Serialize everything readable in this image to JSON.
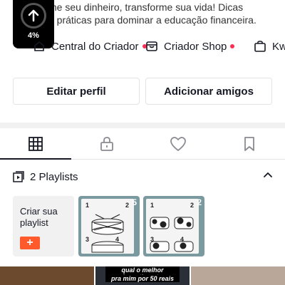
{
  "bio": {
    "line1": "me seu dinheiro, transforme sua vida! Dicas",
    "line2": "e práticas para dominar a educação financeira."
  },
  "upload": {
    "percent_label": "4%",
    "progress": 0.04,
    "icon": "arrow-up-icon"
  },
  "links": {
    "central": "Central do Criador",
    "shop": "Criador Shop",
    "kw": "Kw"
  },
  "actions": {
    "edit_profile": "Editar perfil",
    "add_friends": "Adicionar amigos"
  },
  "tabs": [
    {
      "icon": "grid-icon",
      "selected": true
    },
    {
      "icon": "lock-icon",
      "selected": false
    },
    {
      "icon": "heart-icon",
      "selected": false
    },
    {
      "icon": "bookmark-icon",
      "selected": false
    }
  ],
  "playlists": {
    "header": "2 Playlists",
    "create_label": "Criar sua playlist",
    "create_plus": "+",
    "cards": [
      {
        "count": "5",
        "nums": [
          "1",
          "2",
          "3",
          "4"
        ]
      },
      {
        "count": "2",
        "nums": [
          "1",
          "2",
          "3",
          "4"
        ]
      }
    ]
  },
  "thumbnails": {
    "middle_caption1": "qual o melhor investimento",
    "middle_caption2": "pra mim por 50 reais"
  },
  "colors": {
    "accent": "#fe2c55",
    "text": "#161823",
    "border": "#e3e3e4"
  }
}
